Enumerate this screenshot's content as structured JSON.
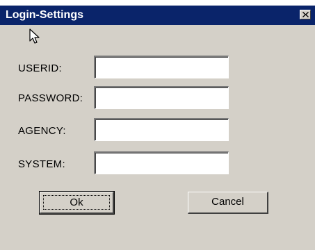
{
  "window": {
    "title": "Login-Settings",
    "titlebar_color": "#0a246a",
    "background_color": "#d4d0c8",
    "close_icon": "close-x-icon"
  },
  "form": {
    "userid_label": "USERID:",
    "userid_value": "",
    "password_label": "PASSWORD:",
    "password_value": "",
    "agency_label": "AGENCY:",
    "agency_value": "",
    "system_label": "SYSTEM:",
    "system_value": ""
  },
  "buttons": {
    "ok_label": "Ok",
    "cancel_label": "Cancel"
  },
  "cursor_icon": "mouse-pointer-icon"
}
